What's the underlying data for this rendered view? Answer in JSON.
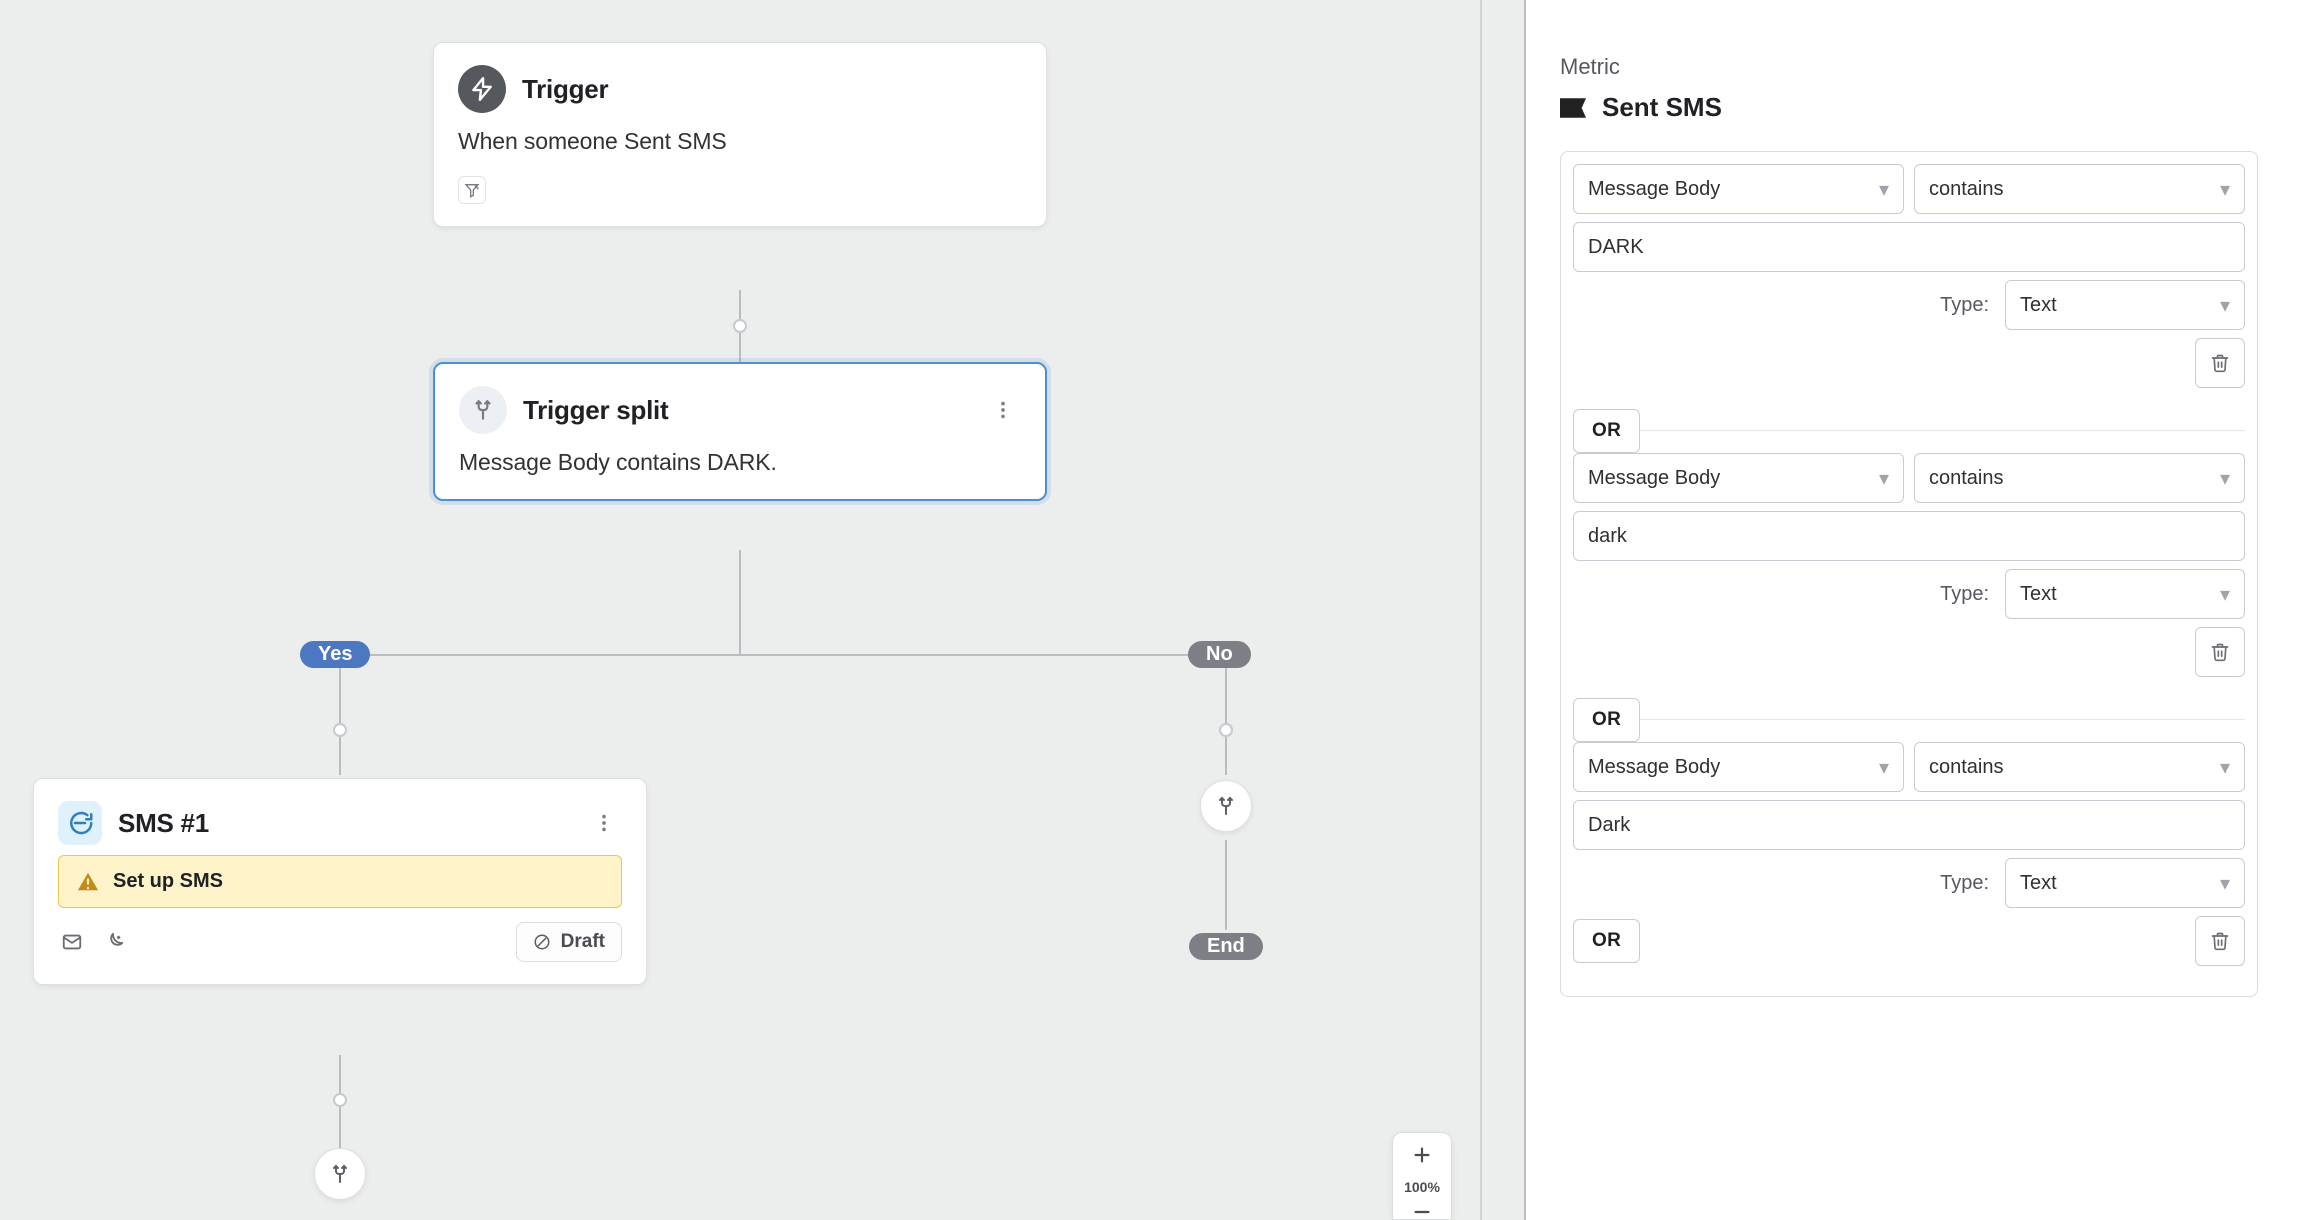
{
  "canvas": {
    "trigger": {
      "title": "Trigger",
      "body": "When someone Sent SMS"
    },
    "split": {
      "title": "Trigger split",
      "body": "Message Body contains DARK."
    },
    "branches": {
      "yes": "Yes",
      "no": "No",
      "end": "End"
    },
    "sms": {
      "title": "SMS #1",
      "warning": "Set up SMS",
      "status": "Draft"
    },
    "zoom": "100%"
  },
  "panel": {
    "section_label": "Metric",
    "metric_name": "Sent SMS",
    "or_label": "OR",
    "type_label": "Type:",
    "conditions": [
      {
        "field": "Message Body",
        "operator": "contains",
        "value": "DARK",
        "type": "Text"
      },
      {
        "field": "Message Body",
        "operator": "contains",
        "value": "dark",
        "type": "Text"
      },
      {
        "field": "Message Body",
        "operator": "contains",
        "value": "Dark",
        "type": "Text"
      }
    ]
  }
}
